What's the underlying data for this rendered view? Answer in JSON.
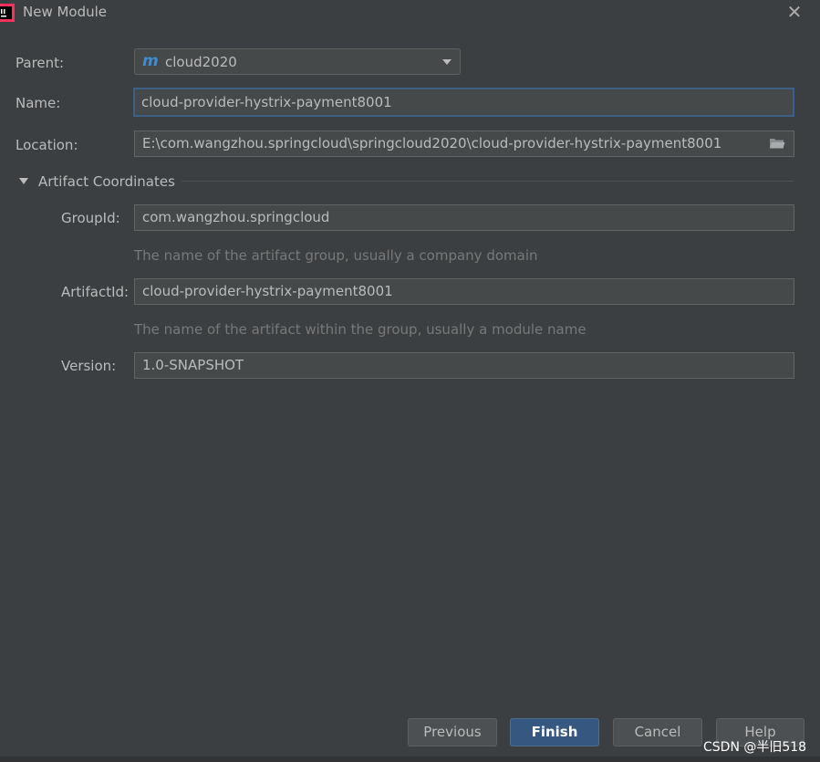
{
  "window": {
    "title": "New Module"
  },
  "parent": {
    "label": "Parent:",
    "value": "cloud2020"
  },
  "name": {
    "label": "Name:",
    "value": "cloud-provider-hystrix-payment8001"
  },
  "location": {
    "label": "Location:",
    "value": "E:\\com.wangzhou.springcloud\\springcloud2020\\cloud-provider-hystrix-payment8001"
  },
  "artifact": {
    "section_title": "Artifact Coordinates",
    "group_label": "GroupId:",
    "group_value": "com.wangzhou.springcloud",
    "group_hint": "The name of the artifact group, usually a company domain",
    "artifact_label": "ArtifactId:",
    "artifact_value": "cloud-provider-hystrix-payment8001",
    "artifact_hint": "The name of the artifact within the group, usually a module name",
    "version_label": "Version:",
    "version_value": "1.0-SNAPSHOT"
  },
  "buttons": {
    "previous": "Previous",
    "finish": "Finish",
    "cancel": "Cancel",
    "help": "Help"
  },
  "watermark": "CSDN @半旧518",
  "icons": {
    "app": "intellij-icon",
    "close": "close-icon",
    "maven": "maven-m-icon",
    "folder": "folder-icon",
    "dropdown": "chevron-down-icon",
    "collapse": "triangle-down-icon"
  },
  "colors": {
    "background": "#3c3f41",
    "field": "#45494a",
    "focus_border": "#3d6185",
    "default_button": "#365880",
    "hint_text": "#787878",
    "maven_icon": "#3d8ed5"
  }
}
